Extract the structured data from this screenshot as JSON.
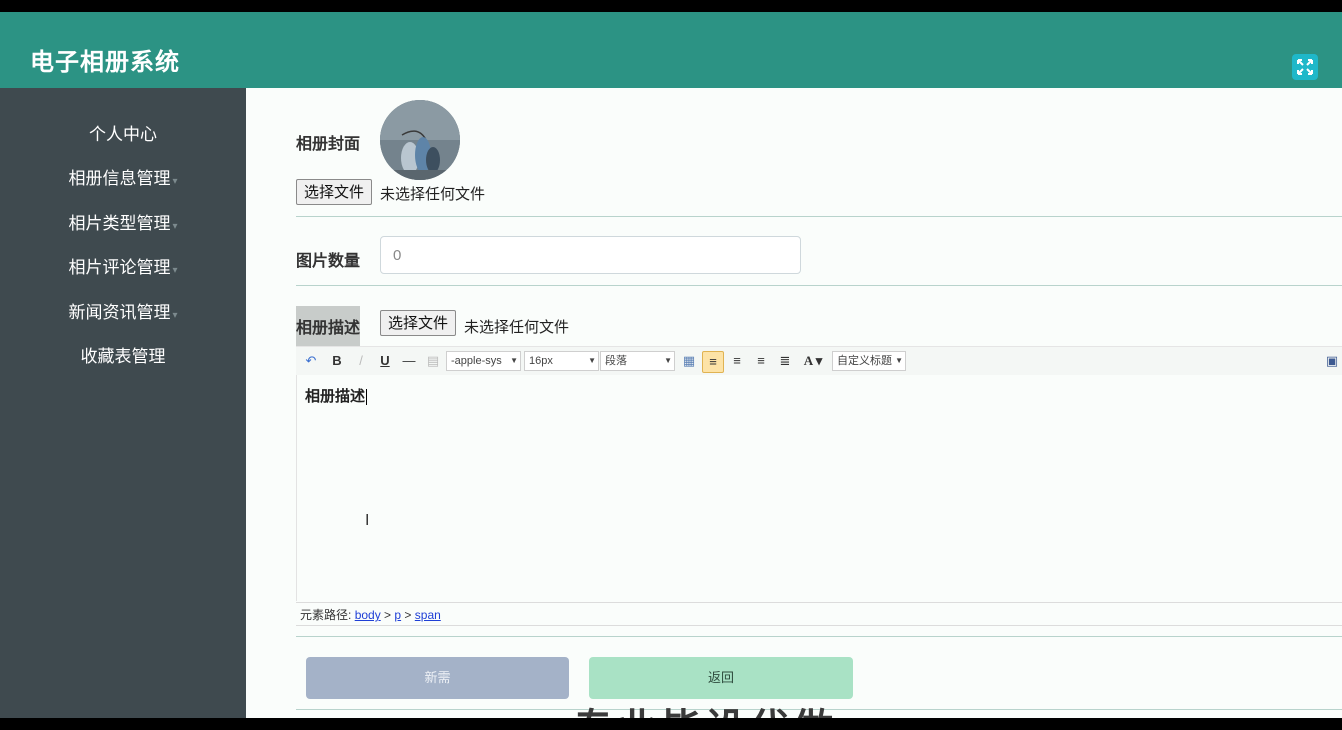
{
  "header": {
    "title": "电子相册系统"
  },
  "sidebar": {
    "items": [
      {
        "label": "个人中心"
      },
      {
        "label": "相册信息管理"
      },
      {
        "label": "相片类型管理"
      },
      {
        "label": "相片评论管理"
      },
      {
        "label": "新闻资讯管理"
      },
      {
        "label": "收藏表管理"
      }
    ]
  },
  "form": {
    "cover": {
      "label": "相册封面",
      "file_button": "选择文件",
      "file_status": "未选择任何文件"
    },
    "count": {
      "label": "图片数量",
      "value": "0"
    },
    "description": {
      "label": "相册描述",
      "file_button": "选择文件",
      "file_status": "未选择任何文件",
      "toolbar": {
        "bold": "B",
        "underline": "U",
        "font_family": "-apple-sys",
        "font_size": "16px",
        "paragraph": "段落",
        "font_color": "A",
        "custom_title": "自定义标题"
      },
      "content": "相册描述",
      "path_label": "元素路径:",
      "path": [
        "body",
        "p",
        "span"
      ]
    },
    "buttons": {
      "save": "新需",
      "back": "返回"
    }
  },
  "watermark": "专业毕设代做"
}
